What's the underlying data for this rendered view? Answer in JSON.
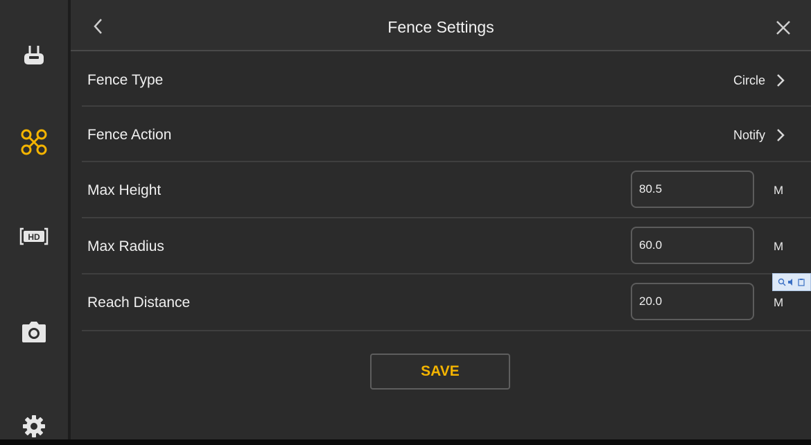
{
  "header": {
    "title": "Fence Settings",
    "back_icon": "chevron-left-icon",
    "close_icon": "close-icon"
  },
  "sidebar": {
    "items": [
      {
        "name": "remote-controller",
        "icon": "remote-controller-icon",
        "active": false
      },
      {
        "name": "aircraft",
        "icon": "drone-icon",
        "active": true
      },
      {
        "name": "hd-transmission",
        "icon": "hd-icon",
        "active": false
      },
      {
        "name": "camera",
        "icon": "camera-icon",
        "active": false
      },
      {
        "name": "settings",
        "icon": "gear-icon",
        "active": false
      }
    ]
  },
  "rows": {
    "fence_type": {
      "label": "Fence Type",
      "value": "Circle"
    },
    "fence_action": {
      "label": "Fence Action",
      "value": "Notify"
    },
    "max_height": {
      "label": "Max Height",
      "value": "80.5",
      "unit": "M"
    },
    "max_radius": {
      "label": "Max Radius",
      "value": "60.0",
      "unit": "M"
    },
    "reach_distance": {
      "label": "Reach Distance",
      "value": "20.0",
      "unit": "M"
    }
  },
  "save_label": "SAVE",
  "colors": {
    "accent": "#f4b400",
    "background": "#2b2b2b",
    "text": "#f0f0f0"
  }
}
